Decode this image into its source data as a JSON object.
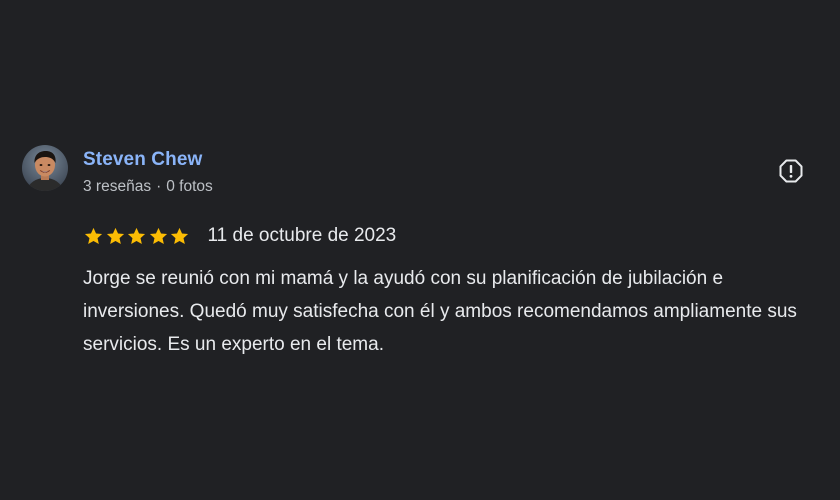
{
  "review": {
    "author": {
      "name": "Steven Chew",
      "reviews_count": "3 reseñas",
      "separator": "·",
      "photos_count": "0 fotos",
      "avatar_icon": "user-avatar-photo"
    },
    "report_icon": "flag-report-icon",
    "rating": {
      "stars": 5,
      "max_stars": 5,
      "star_color": "#fbbc04"
    },
    "date": "11 de octubre de 2023",
    "text": "Jorge se reunió con mi mamá y la ayudó con su planificación de jubilación e inversiones. Quedó muy satisfecha con él y ambos recomendamos ampliamente sus servicios. Es un experto en el tema."
  },
  "colors": {
    "background": "#202124",
    "author_link": "#8ab4f8",
    "primary_text": "#e8eaed",
    "secondary_text": "#bdc1c6"
  }
}
